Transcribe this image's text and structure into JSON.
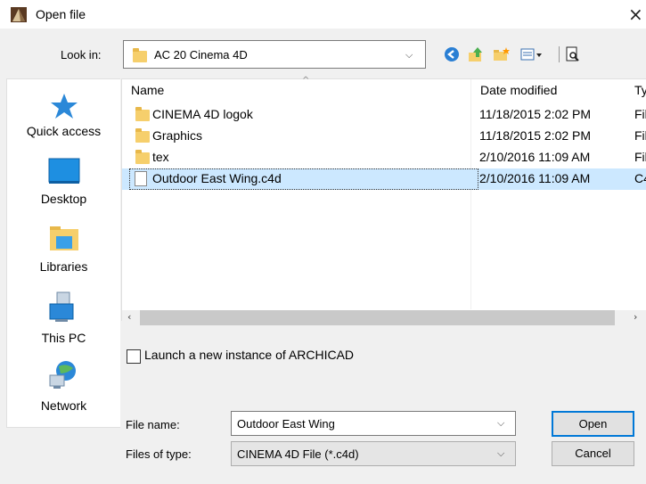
{
  "window": {
    "title": "Open file",
    "close_glyph": "×"
  },
  "look_in": {
    "label": "Look in:",
    "value": "AC 20 Cinema 4D"
  },
  "toolbar": {
    "icons": [
      "back-icon",
      "up-folder-icon",
      "new-folder-icon",
      "view-menu-icon",
      "preview-icon"
    ]
  },
  "sidebar": {
    "items": [
      {
        "label": "Quick access",
        "icon": "star-icon"
      },
      {
        "label": "Desktop",
        "icon": "desktop-icon"
      },
      {
        "label": "Libraries",
        "icon": "libraries-icon"
      },
      {
        "label": "This PC",
        "icon": "pc-icon"
      },
      {
        "label": "Network",
        "icon": "network-icon"
      }
    ]
  },
  "file_list": {
    "columns": {
      "name": "Name",
      "date": "Date modified",
      "type": "Ty"
    },
    "rows": [
      {
        "name": "CINEMA 4D logok",
        "date": "11/18/2015 2:02 PM",
        "type": "Fil",
        "kind": "folder"
      },
      {
        "name": "Graphics",
        "date": "11/18/2015 2:02 PM",
        "type": "Fil",
        "kind": "folder"
      },
      {
        "name": "tex",
        "date": "2/10/2016 11:09 AM",
        "type": "Fil",
        "kind": "folder"
      },
      {
        "name": "Outdoor East Wing.c4d",
        "date": "2/10/2016 11:09 AM",
        "type": "C4",
        "kind": "file",
        "selected": true
      }
    ]
  },
  "launch_checkbox": {
    "label": "Launch a new instance of ARCHICAD",
    "checked": false
  },
  "file_name": {
    "label": "File name:",
    "value": "Outdoor East Wing"
  },
  "file_type": {
    "label": "Files of type:",
    "value": "CINEMA 4D File (*.c4d)"
  },
  "buttons": {
    "open": "Open",
    "cancel": "Cancel"
  },
  "colors": {
    "selection": "#cce8ff",
    "accent": "#0078d7",
    "folder": "#f6cf6c"
  }
}
